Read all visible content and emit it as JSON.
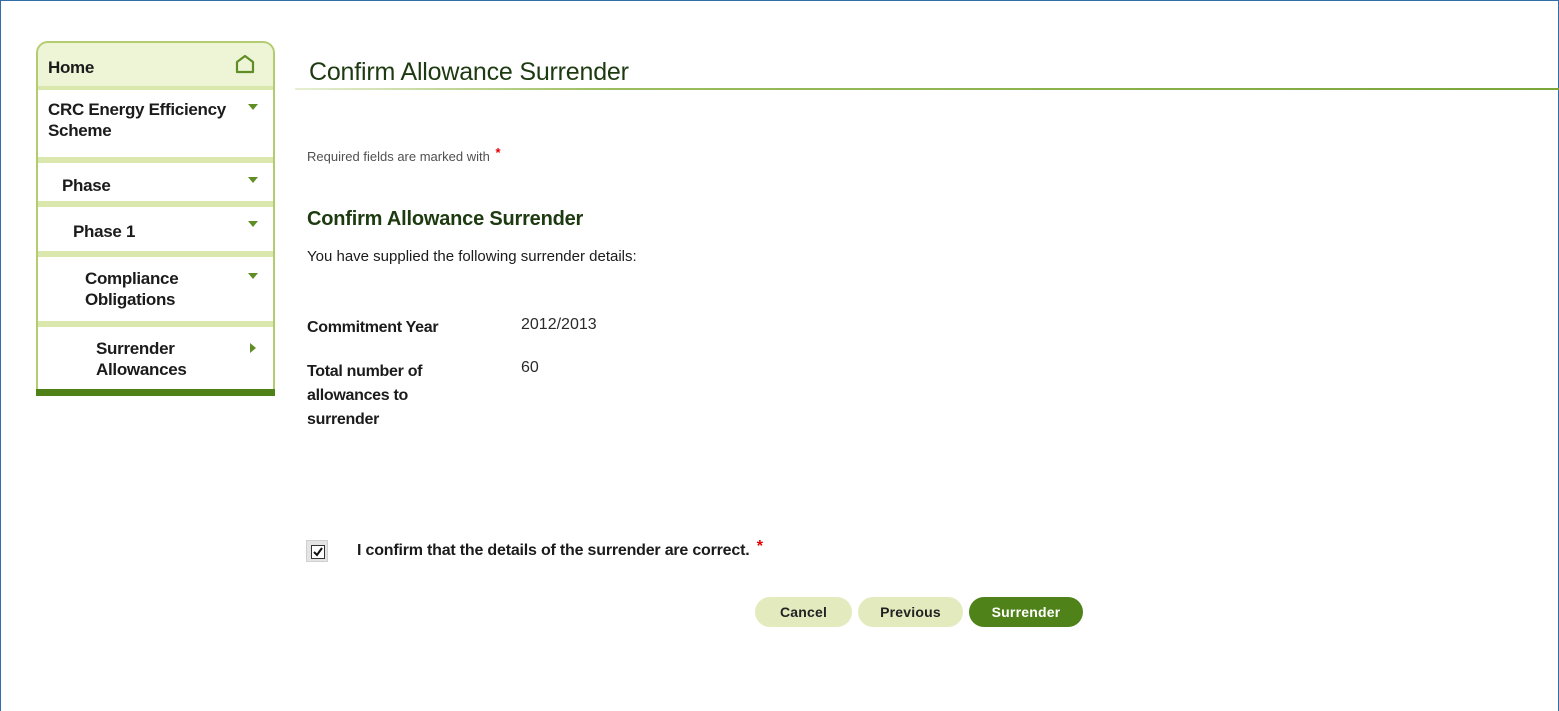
{
  "sidebar": {
    "home_label": "Home",
    "items": [
      {
        "label": "CRC Energy Efficiency Scheme"
      },
      {
        "label": "Phase"
      },
      {
        "label": "Phase 1"
      },
      {
        "label": "Compliance Obligations"
      },
      {
        "label": "Surrender Allowances"
      }
    ]
  },
  "main": {
    "page_title": "Confirm Allowance Surrender",
    "required_note": "Required fields are marked with",
    "required_marker": "*",
    "section_title": "Confirm Allowance Surrender",
    "intro": "You have supplied the following surrender details:",
    "details": {
      "commitment_year_label": "Commitment Year",
      "commitment_year_value": "2012/2013",
      "total_label": "Total number of allowances to surrender",
      "total_value": "60"
    },
    "confirm": {
      "label": "I confirm that the details of the surrender are correct.",
      "checked": true
    },
    "buttons": {
      "cancel": "Cancel",
      "previous": "Previous",
      "surrender": "Surrender"
    }
  },
  "colors": {
    "accent_dark_green": "#4f8219",
    "accent_light_green": "#e3ebbe",
    "heading_green": "#1d3a10",
    "required_red": "#e00000",
    "frame_blue": "#2f6ea8"
  },
  "icons": {
    "home": "home-icon",
    "expand": "chevron-down-icon",
    "current": "chevron-right-icon",
    "checkbox": "checkbox-checked-icon"
  }
}
